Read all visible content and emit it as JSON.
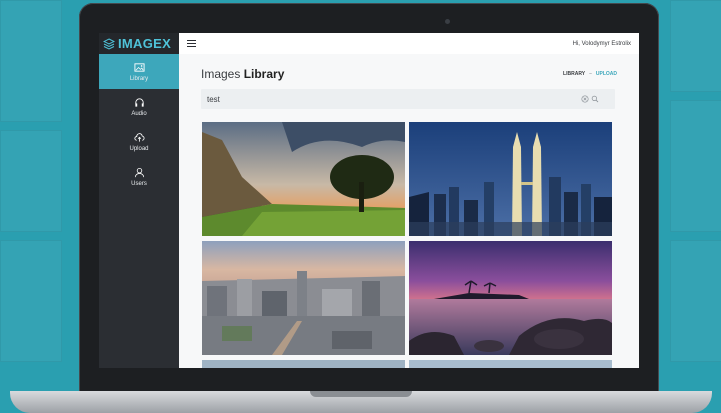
{
  "app": {
    "brand": "IMAGEX"
  },
  "sidebar": {
    "items": [
      {
        "label": "Library",
        "icon": "image-icon",
        "active": true
      },
      {
        "label": "Audio",
        "icon": "headphones-icon",
        "active": false
      },
      {
        "label": "Upload",
        "icon": "cloud-upload-icon",
        "active": false
      },
      {
        "label": "Users",
        "icon": "user-icon",
        "active": false
      }
    ]
  },
  "topbar": {
    "greeting": "Hi, Volodymyr Estrolix",
    "menu_icon": "hamburger-icon"
  },
  "main": {
    "title_light": "Images ",
    "title_bold": "Library",
    "breadcrumb": {
      "current": "LIBRARY",
      "separator": "–",
      "link": "UPLOAD"
    },
    "search": {
      "value": "test",
      "clear_icon": "clear-icon",
      "search_icon": "search-icon"
    },
    "images": [
      {
        "subject": "mountain-valley-tree-sunset"
      },
      {
        "subject": "twin-towers-city-night"
      },
      {
        "subject": "city-skyline-dusk"
      },
      {
        "subject": "rocky-beach-sunset"
      }
    ]
  },
  "colors": {
    "accent": "#3da7bb",
    "sidebar": "#2b2e33",
    "background": "#2a9fb0"
  }
}
